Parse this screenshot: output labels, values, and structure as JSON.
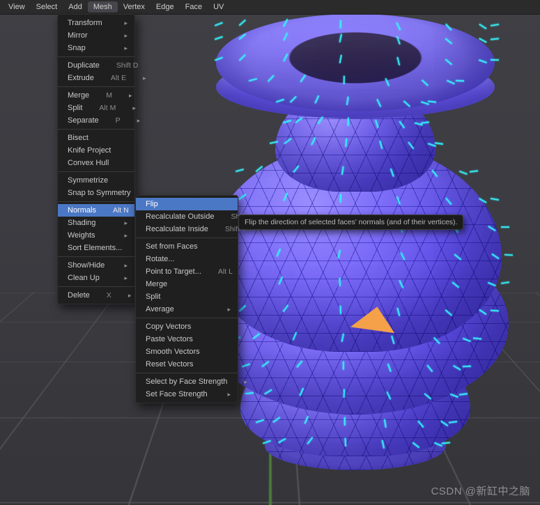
{
  "menubar": {
    "items": [
      "View",
      "Select",
      "Add",
      "Mesh",
      "Vertex",
      "Edge",
      "Face",
      "UV"
    ],
    "active_index": 3
  },
  "mesh_menu": [
    {
      "label": "Transform",
      "submenu": true
    },
    {
      "label": "Mirror",
      "submenu": true
    },
    {
      "label": "Snap",
      "submenu": true
    },
    {
      "sep": true
    },
    {
      "label": "Duplicate",
      "shortcut": "Shift D"
    },
    {
      "label": "Extrude",
      "shortcut": "Alt E",
      "submenu": true
    },
    {
      "sep": true
    },
    {
      "label": "Merge",
      "shortcut": "M",
      "submenu": true
    },
    {
      "label": "Split",
      "shortcut": "Alt M",
      "submenu": true
    },
    {
      "label": "Separate",
      "shortcut": "P",
      "submenu": true
    },
    {
      "sep": true
    },
    {
      "label": "Bisect"
    },
    {
      "label": "Knife Project"
    },
    {
      "label": "Convex Hull"
    },
    {
      "sep": true
    },
    {
      "label": "Symmetrize"
    },
    {
      "label": "Snap to Symmetry"
    },
    {
      "sep": true
    },
    {
      "label": "Normals",
      "shortcut": "Alt N",
      "submenu": true,
      "highlight": true
    },
    {
      "label": "Shading",
      "submenu": true
    },
    {
      "label": "Weights",
      "submenu": true
    },
    {
      "label": "Sort Elements...",
      "submenu": true
    },
    {
      "sep": true
    },
    {
      "label": "Show/Hide",
      "submenu": true
    },
    {
      "label": "Clean Up",
      "submenu": true
    },
    {
      "sep": true
    },
    {
      "label": "Delete",
      "shortcut": "X",
      "submenu": true
    }
  ],
  "normals_menu": [
    {
      "label": "Flip",
      "highlight": true
    },
    {
      "label": "Recalculate Outside",
      "shortcut": "Shift N"
    },
    {
      "label": "Recalculate Inside",
      "shortcut": "Shift Ctrl N"
    },
    {
      "sep": true
    },
    {
      "label": "Set from Faces"
    },
    {
      "label": "Rotate..."
    },
    {
      "label": "Point to Target...",
      "shortcut": "Alt L"
    },
    {
      "label": "Merge"
    },
    {
      "label": "Split"
    },
    {
      "label": "Average",
      "submenu": true
    },
    {
      "sep": true
    },
    {
      "label": "Copy Vectors"
    },
    {
      "label": "Paste Vectors"
    },
    {
      "label": "Smooth Vectors"
    },
    {
      "label": "Reset Vectors"
    },
    {
      "sep": true
    },
    {
      "label": "Select by Face Strength",
      "submenu": true
    },
    {
      "label": "Set Face Strength",
      "submenu": true
    }
  ],
  "tooltip": "Flip the direction of selected faces' normals (and of their vertices).",
  "watermark": "CSDN @新缸中之脑"
}
